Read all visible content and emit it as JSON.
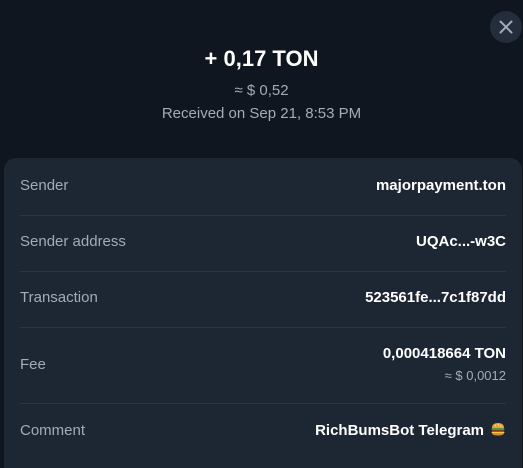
{
  "header": {
    "amount": "+ 0,17 TON",
    "fiat": "≈ $ 0,52",
    "received": "Received on Sep 21, 8:53 PM"
  },
  "details": {
    "sender": {
      "label": "Sender",
      "value": "majorpayment.ton"
    },
    "sender_address": {
      "label": "Sender address",
      "value": "UQAc...-w3C"
    },
    "transaction": {
      "label": "Transaction",
      "value": "523561fe...7c1f87dd"
    },
    "fee": {
      "label": "Fee",
      "value": "0,000418664 TON",
      "fiat": "≈ $ 0,0012"
    },
    "comment": {
      "label": "Comment",
      "value": "RichBumsBot Telegram",
      "emoji": "burger-emoji"
    }
  },
  "icons": {
    "close": "close-icon"
  },
  "colors": {
    "background": "#10161f",
    "panel": "#1d2633",
    "muted_text": "#a2acb8",
    "close_button_bg": "#232d3b"
  }
}
